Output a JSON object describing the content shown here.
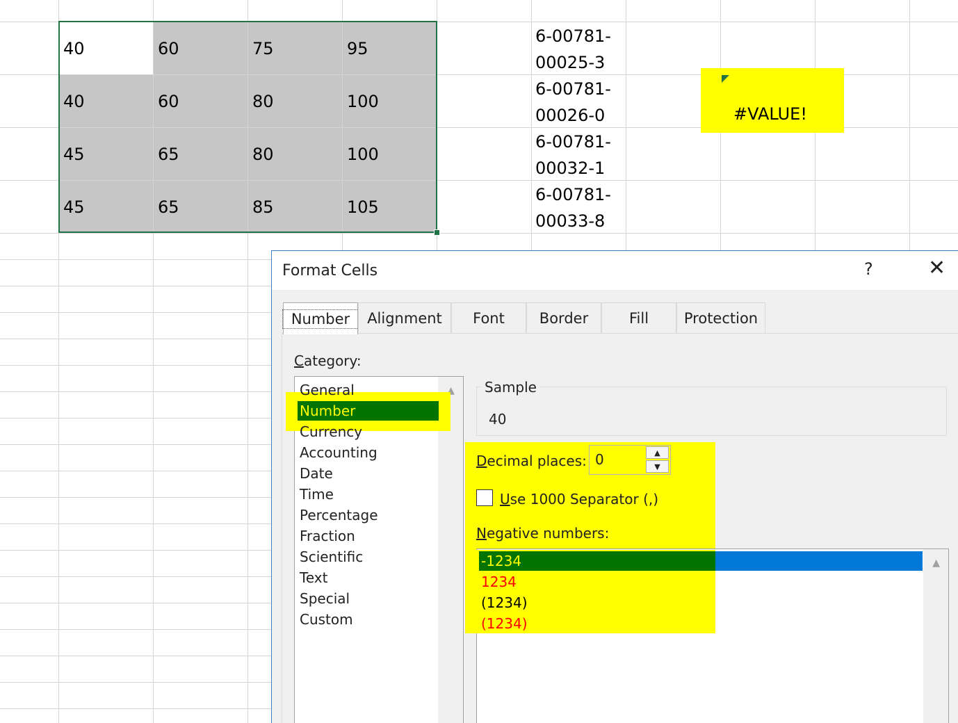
{
  "sheet": {
    "grid": [
      [
        "40",
        "60",
        "75",
        "95"
      ],
      [
        "40",
        "60",
        "80",
        "100"
      ],
      [
        "45",
        "65",
        "80",
        "100"
      ],
      [
        "45",
        "65",
        "85",
        "105"
      ]
    ],
    "codes": [
      [
        "6-00781-",
        "00025-3"
      ],
      [
        "6-00781-",
        "00026-0"
      ],
      [
        "6-00781-",
        "00032-1"
      ],
      [
        "6-00781-",
        "00033-8"
      ]
    ],
    "error_value": "#VALUE!",
    "colors": {
      "selection_border": "#217346",
      "selection_fill": "#c6c6c6",
      "highlight": "#ffff00"
    }
  },
  "dialog": {
    "title": "Format Cells",
    "help_label": "?",
    "close_icon": "close-icon",
    "tabs": [
      "Number",
      "Alignment",
      "Font",
      "Border",
      "Fill",
      "Protection"
    ],
    "active_tab": "Number",
    "category_label_first": "C",
    "category_label_rest": "ategory:",
    "categories": [
      "General",
      "Number",
      "Currency",
      "Accounting",
      "Date",
      "Time",
      "Percentage",
      "Fraction",
      "Scientific",
      "Text",
      "Special",
      "Custom"
    ],
    "selected_category": "Number",
    "sample_label": "Sample",
    "sample_value": "40",
    "decimal_label_first": "D",
    "decimal_label_rest": "ecimal places:",
    "decimal_value": "0",
    "separator_label_first": "U",
    "separator_label_rest": "se 1000 Separator (,)",
    "separator_checked": false,
    "negative_label_first": "N",
    "negative_label_rest": "egative numbers:",
    "negative_options": [
      {
        "label": "-1234",
        "color": "#ffff00",
        "selected": true
      },
      {
        "label": "1234",
        "color": "#ff0000",
        "selected": false
      },
      {
        "label": "(1234)",
        "color": "#000000",
        "selected": false
      },
      {
        "label": "(1234)",
        "color": "#ff0000",
        "selected": false
      }
    ],
    "colors": {
      "selected_item_bg": "#007300",
      "selected_item_text": "#ffff00",
      "list_selection_blue": "#0078d7"
    }
  }
}
